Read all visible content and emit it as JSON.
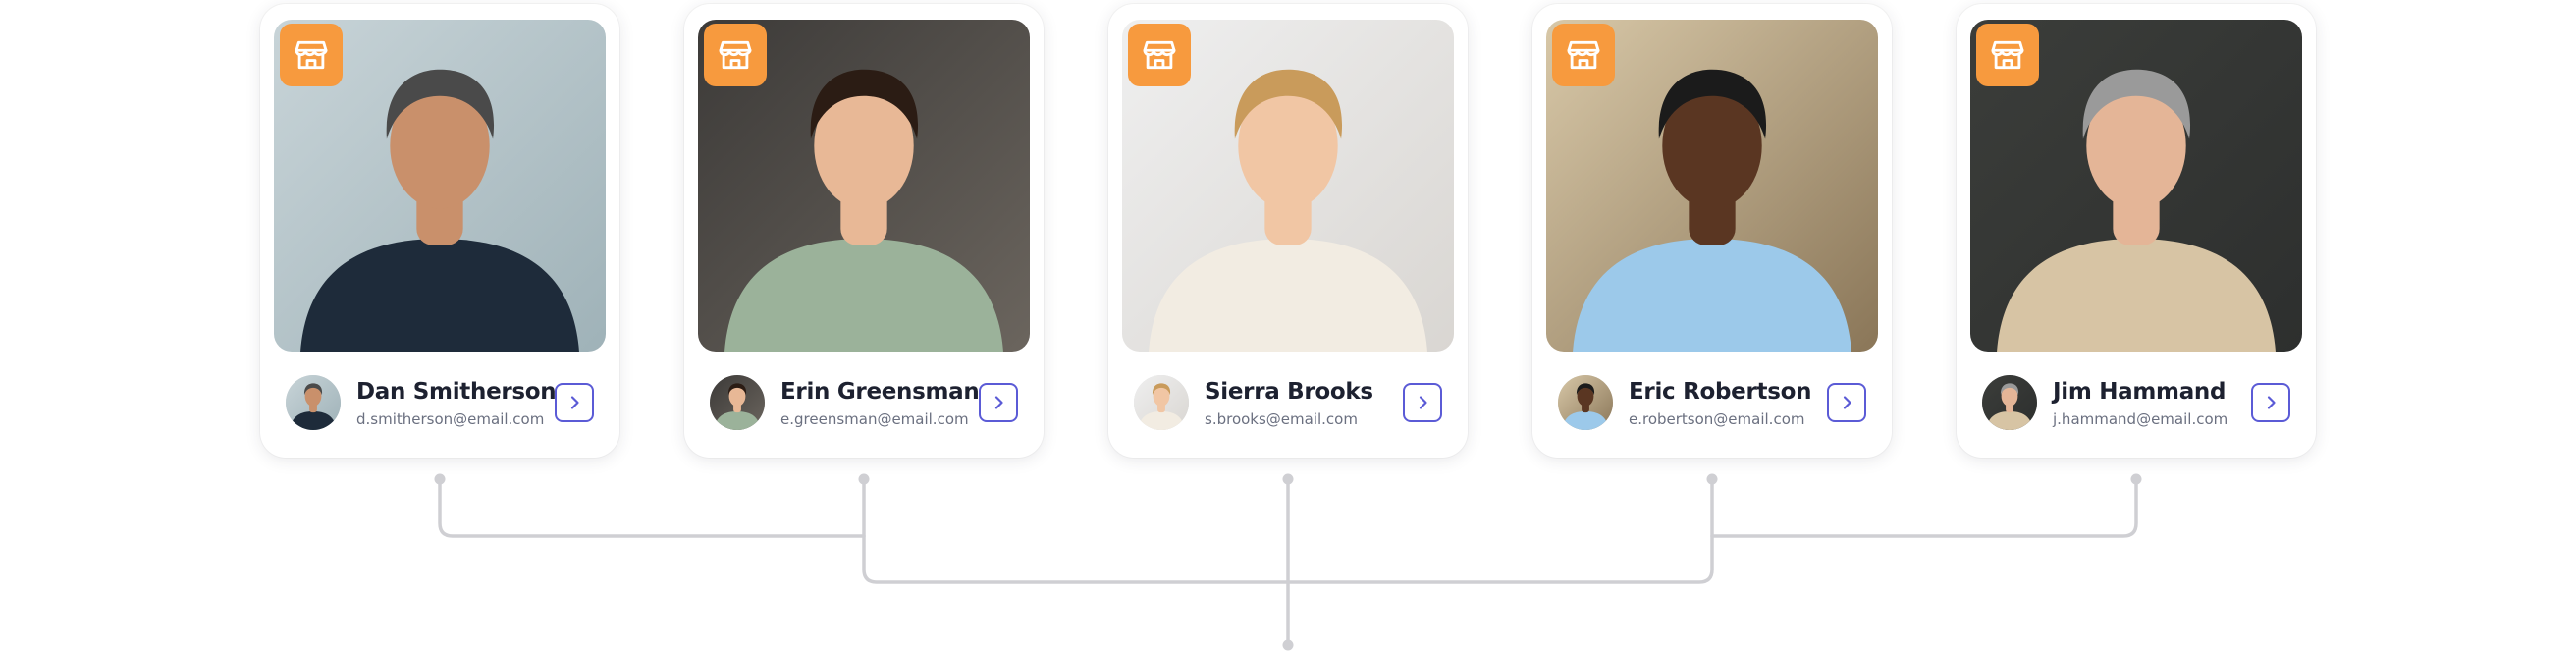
{
  "people": [
    {
      "name": "Dan Smitherson",
      "email": "d.smitherson@email.com",
      "photo": {
        "bg": "#c8d4d8",
        "bg2": "#9fb2b8",
        "skin": "#c9906b",
        "hair": "#4a4a4a",
        "top": "#1e2b3a"
      }
    },
    {
      "name": "Erin Greensman",
      "email": "e.greensman@email.com",
      "photo": {
        "bg": "#3c3a38",
        "bg2": "#6b655e",
        "skin": "#e8b896",
        "hair": "#2b1c14",
        "top": "#9bb29a"
      }
    },
    {
      "name": "Sierra Brooks",
      "email": "s.brooks@email.com",
      "photo": {
        "bg": "#efefef",
        "bg2": "#d9d6d2",
        "skin": "#f1c6a4",
        "hair": "#c99b5b",
        "top": "#f2ece2"
      }
    },
    {
      "name": "Eric Robertson",
      "email": "e.robertson@email.com",
      "photo": {
        "bg": "#d8c8a8",
        "bg2": "#8a7658",
        "skin": "#5a3622",
        "hair": "#1b1b1b",
        "top": "#9cc9ea"
      }
    },
    {
      "name": "Jim Hammand",
      "email": "j.hammand@email.com",
      "photo": {
        "bg": "#3b3d3a",
        "bg2": "#2d2f2e",
        "skin": "#e4b597",
        "hair": "#9a9a9a",
        "top": "#d7c4a4"
      }
    }
  ],
  "colors": {
    "accent": "#5b5bd6",
    "badge": "#f79a3e",
    "connector": "#cfcfd3"
  },
  "icons": {
    "badge": "storefront-icon",
    "action": "chevron-right-icon"
  }
}
